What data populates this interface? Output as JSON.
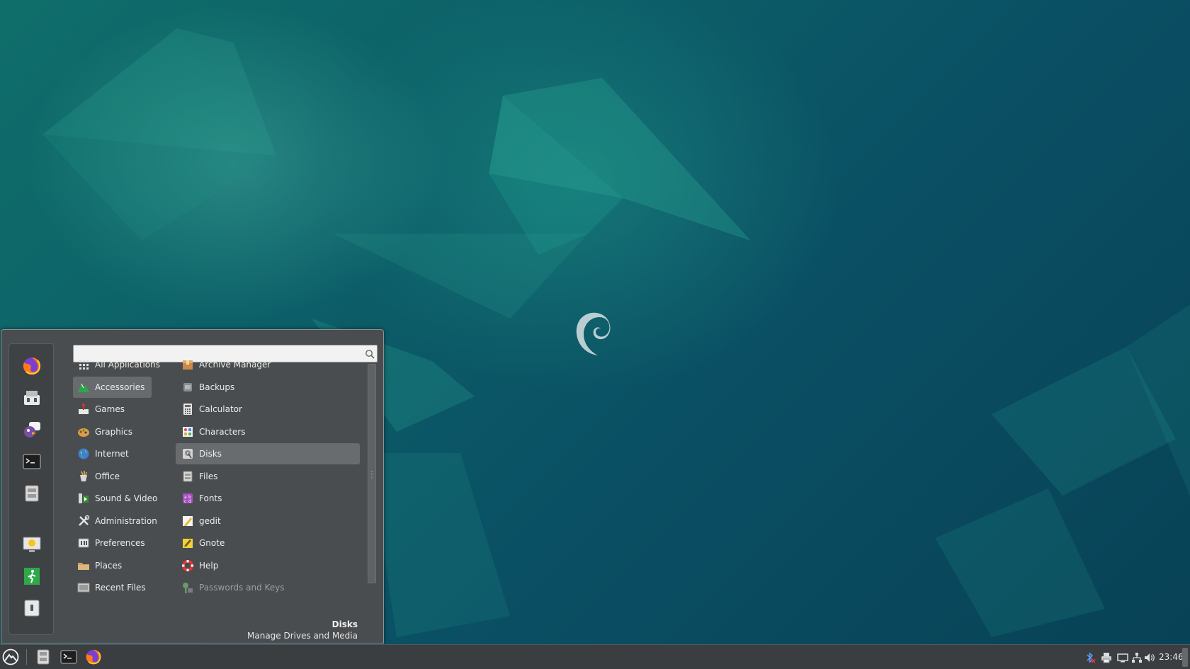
{
  "search": {
    "value": "",
    "placeholder": ""
  },
  "favorites": [
    {
      "name": "Firefox",
      "icon": "firefox-icon"
    },
    {
      "name": "Software Manager",
      "icon": "software-manager-icon"
    },
    {
      "name": "Pidgin",
      "icon": "pidgin-icon"
    },
    {
      "name": "Terminal",
      "icon": "terminal-icon"
    },
    {
      "name": "Files",
      "icon": "file-manager-icon"
    },
    {
      "name": "Lock Screen",
      "icon": "lock-screen-icon"
    },
    {
      "name": "Log Out",
      "icon": "logout-icon"
    },
    {
      "name": "Shut Down",
      "icon": "shutdown-icon"
    }
  ],
  "categories": [
    {
      "label": "All Applications",
      "icon": "grid-icon"
    },
    {
      "label": "Accessories",
      "icon": "accessories-icon",
      "selected": true
    },
    {
      "label": "Games",
      "icon": "games-icon"
    },
    {
      "label": "Graphics",
      "icon": "graphics-icon"
    },
    {
      "label": "Internet",
      "icon": "internet-icon"
    },
    {
      "label": "Office",
      "icon": "office-icon"
    },
    {
      "label": "Sound & Video",
      "icon": "sound-video-icon"
    },
    {
      "label": "Administration",
      "icon": "administration-icon"
    },
    {
      "label": "Preferences",
      "icon": "preferences-icon"
    },
    {
      "label": "Places",
      "icon": "places-folder-icon"
    },
    {
      "label": "Recent Files",
      "icon": "recent-files-icon"
    }
  ],
  "apps": [
    {
      "label": "Archive Manager",
      "icon": "archive-manager-icon"
    },
    {
      "label": "Backups",
      "icon": "backups-icon"
    },
    {
      "label": "Calculator",
      "icon": "calculator-icon"
    },
    {
      "label": "Characters",
      "icon": "characters-icon"
    },
    {
      "label": "Disks",
      "icon": "disks-icon",
      "selected": true
    },
    {
      "label": "Files",
      "icon": "files-icon"
    },
    {
      "label": "Fonts",
      "icon": "fonts-icon"
    },
    {
      "label": "gedit",
      "icon": "gedit-icon"
    },
    {
      "label": "Gnote",
      "icon": "gnote-icon"
    },
    {
      "label": "Help",
      "icon": "help-icon"
    },
    {
      "label": "Passwords and Keys",
      "icon": "passwords-keys-icon",
      "dim": true
    }
  ],
  "description": {
    "title": "Disks",
    "text": "Manage Drives and Media"
  },
  "panel": {
    "clock": "23:46",
    "launchers": [
      "menu-icon",
      "file-manager-icon",
      "terminal-icon",
      "firefox-icon"
    ],
    "tray": [
      "bluetooth-disabled-icon",
      "printer-icon",
      "display-icon",
      "network-icon",
      "volume-icon"
    ]
  },
  "colors": {
    "menu_bg": "#4a4d4f",
    "selected_bg": "#686c6f",
    "panel_bg": "#3b3e40"
  }
}
